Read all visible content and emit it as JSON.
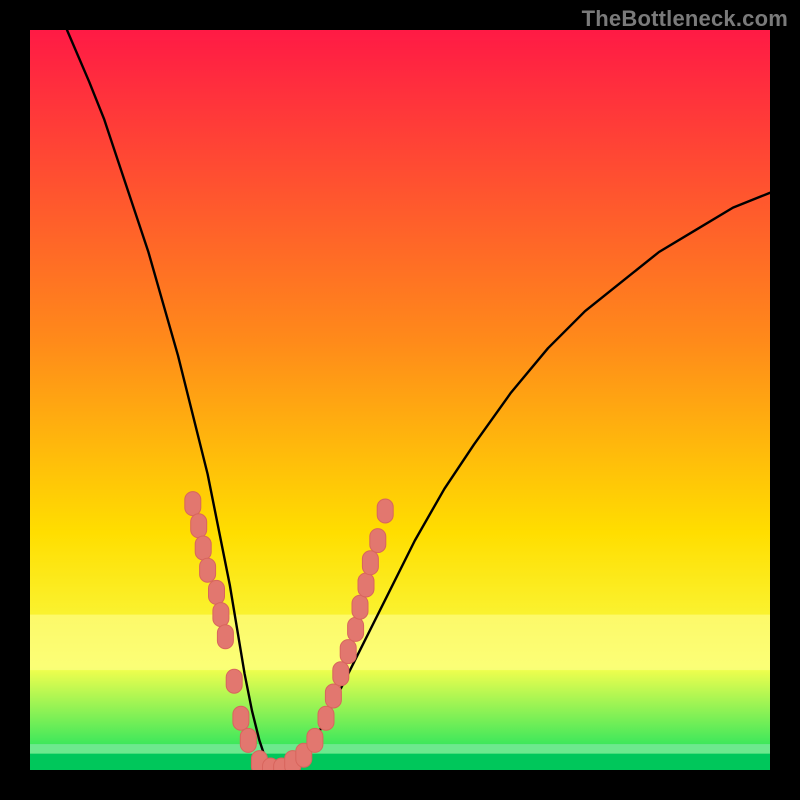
{
  "watermark": "TheBottleneck.com",
  "colors": {
    "bg_black": "#000000",
    "curve": "#000000",
    "marker_fill": "#e2776f",
    "marker_stroke": "#d8655d",
    "grad_top": "#ff1a45",
    "grad_mid": "#ffde00",
    "grad_bottom": "#00e060",
    "band_pale_yellow": "#ffff99",
    "band_green_light": "#6de88e",
    "band_green_dark": "#00c75b"
  },
  "chart_data": {
    "type": "line",
    "title": "",
    "xlabel": "",
    "ylabel": "",
    "xlim": [
      0,
      100
    ],
    "ylim": [
      0,
      100
    ],
    "series": [
      {
        "name": "bottleneck-curve",
        "x": [
          5,
          8,
          10,
          12,
          14,
          16,
          18,
          20,
          22,
          24,
          25,
          26,
          27,
          28,
          29,
          30,
          31,
          32,
          33,
          34,
          35,
          36,
          38,
          40,
          42,
          45,
          48,
          52,
          56,
          60,
          65,
          70,
          75,
          80,
          85,
          90,
          95,
          100
        ],
        "y": [
          100,
          93,
          88,
          82,
          76,
          70,
          63,
          56,
          48,
          40,
          35,
          30,
          25,
          19,
          13,
          8,
          4,
          1,
          0,
          0,
          0,
          1,
          3,
          7,
          11,
          17,
          23,
          31,
          38,
          44,
          51,
          57,
          62,
          66,
          70,
          73,
          76,
          78
        ]
      }
    ],
    "markers": [
      {
        "x": 22.0,
        "y": 36
      },
      {
        "x": 22.8,
        "y": 33
      },
      {
        "x": 23.4,
        "y": 30
      },
      {
        "x": 24.0,
        "y": 27
      },
      {
        "x": 25.2,
        "y": 24
      },
      {
        "x": 25.8,
        "y": 21
      },
      {
        "x": 26.4,
        "y": 18
      },
      {
        "x": 27.6,
        "y": 12
      },
      {
        "x": 28.5,
        "y": 7
      },
      {
        "x": 29.5,
        "y": 4
      },
      {
        "x": 31.0,
        "y": 1
      },
      {
        "x": 32.5,
        "y": 0
      },
      {
        "x": 34.0,
        "y": 0
      },
      {
        "x": 35.5,
        "y": 1
      },
      {
        "x": 37.0,
        "y": 2
      },
      {
        "x": 38.5,
        "y": 4
      },
      {
        "x": 40.0,
        "y": 7
      },
      {
        "x": 41.0,
        "y": 10
      },
      {
        "x": 42.0,
        "y": 13
      },
      {
        "x": 43.0,
        "y": 16
      },
      {
        "x": 44.0,
        "y": 19
      },
      {
        "x": 44.6,
        "y": 22
      },
      {
        "x": 45.4,
        "y": 25
      },
      {
        "x": 46.0,
        "y": 28
      },
      {
        "x": 47.0,
        "y": 31
      },
      {
        "x": 48.0,
        "y": 35
      }
    ]
  }
}
